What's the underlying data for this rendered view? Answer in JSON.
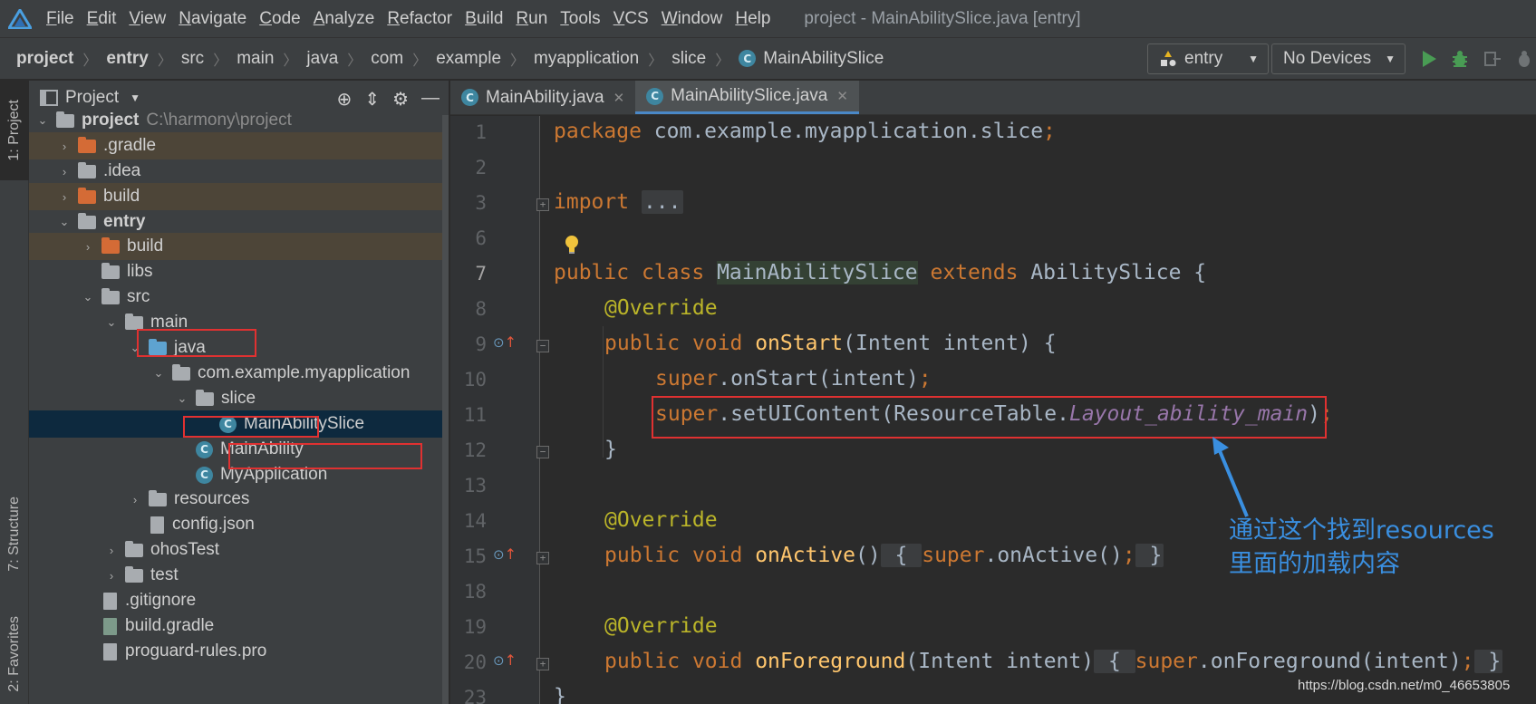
{
  "menubar": {
    "items": [
      "File",
      "Edit",
      "View",
      "Navigate",
      "Code",
      "Analyze",
      "Refactor",
      "Build",
      "Run",
      "Tools",
      "VCS",
      "Window",
      "Help"
    ],
    "window_title": "project - MainAbilitySlice.java [entry]"
  },
  "breadcrumb": {
    "items": [
      "project",
      "entry",
      "src",
      "main",
      "java",
      "com",
      "example",
      "myapplication",
      "slice"
    ],
    "current": "MainAbilitySlice"
  },
  "toolbar": {
    "run_config": "entry",
    "device": "No Devices"
  },
  "toolstrip": {
    "project_tab": "1: Project",
    "structure_tab": "7: Structure",
    "favorites_tab": "2: Favorites"
  },
  "project_panel": {
    "title": "Project",
    "root_name": "project",
    "root_path": "C:\\harmony\\project",
    "tree": [
      {
        "label": "project"
      },
      {
        "label": ".gradle"
      },
      {
        "label": ".idea"
      },
      {
        "label": "build"
      },
      {
        "label": "entry"
      },
      {
        "label": "build"
      },
      {
        "label": "libs"
      },
      {
        "label": "src"
      },
      {
        "label": "main"
      },
      {
        "label": "java"
      },
      {
        "label": "com.example.myapplication"
      },
      {
        "label": "slice"
      },
      {
        "label": "MainAbilitySlice"
      },
      {
        "label": "MainAbility"
      },
      {
        "label": "MyApplication"
      },
      {
        "label": "resources"
      },
      {
        "label": "config.json"
      },
      {
        "label": "ohosTest"
      },
      {
        "label": "test"
      },
      {
        "label": ".gitignore"
      },
      {
        "label": "build.gradle"
      },
      {
        "label": "proguard-rules.pro"
      }
    ]
  },
  "editor": {
    "tabs": [
      {
        "label": "MainAbility.java",
        "active": false
      },
      {
        "label": "MainAbilitySlice.java",
        "active": true
      }
    ],
    "line_numbers": [
      "1",
      "2",
      "3",
      "6",
      "7",
      "8",
      "9",
      "10",
      "11",
      "12",
      "13",
      "14",
      "15",
      "18",
      "19",
      "20",
      "23"
    ],
    "code": {
      "package_kw": "package",
      "package_name": " com.example.myapplication.slice",
      "semicolon": ";",
      "import_kw": "import",
      "import_fold": "...",
      "public": "public",
      "class": "class",
      "void": "void",
      "extends": "extends",
      "super": "super",
      "class_name": "MainAbilitySlice",
      "parent_class": "AbilitySlice",
      "open_brace": " {",
      "close_brace": "}",
      "override": "@Override",
      "on_start": "onStart",
      "on_start_params": "(Intent intent) {",
      "super_on_start": ".onStart(intent)",
      "set_ui_content": ".setUIContent(ResourceTable.",
      "layout_field": "Layout_ability_main",
      "close_paren": ")",
      "on_active": "onActive",
      "empty_params": "()",
      "super_on_active": ".onActive()",
      "on_foreground": "onForeground",
      "on_foreground_params": "(Intent intent)",
      "super_on_foreground": ".onForeground(intent)",
      "fold_open": " { ",
      "fold_close": " }"
    }
  },
  "annotation": {
    "line1": "通过这个找到resources",
    "line2": "里面的加载内容"
  },
  "watermark": "https://blog.csdn.net/m0_46653805",
  "colors": {
    "annotation_blue": "#3a8fe0",
    "highlight_red": "#e03131",
    "keyword": "#cc7832",
    "annotation": "#bbb529",
    "method": "#ffc66d",
    "field": "#9876aa"
  }
}
